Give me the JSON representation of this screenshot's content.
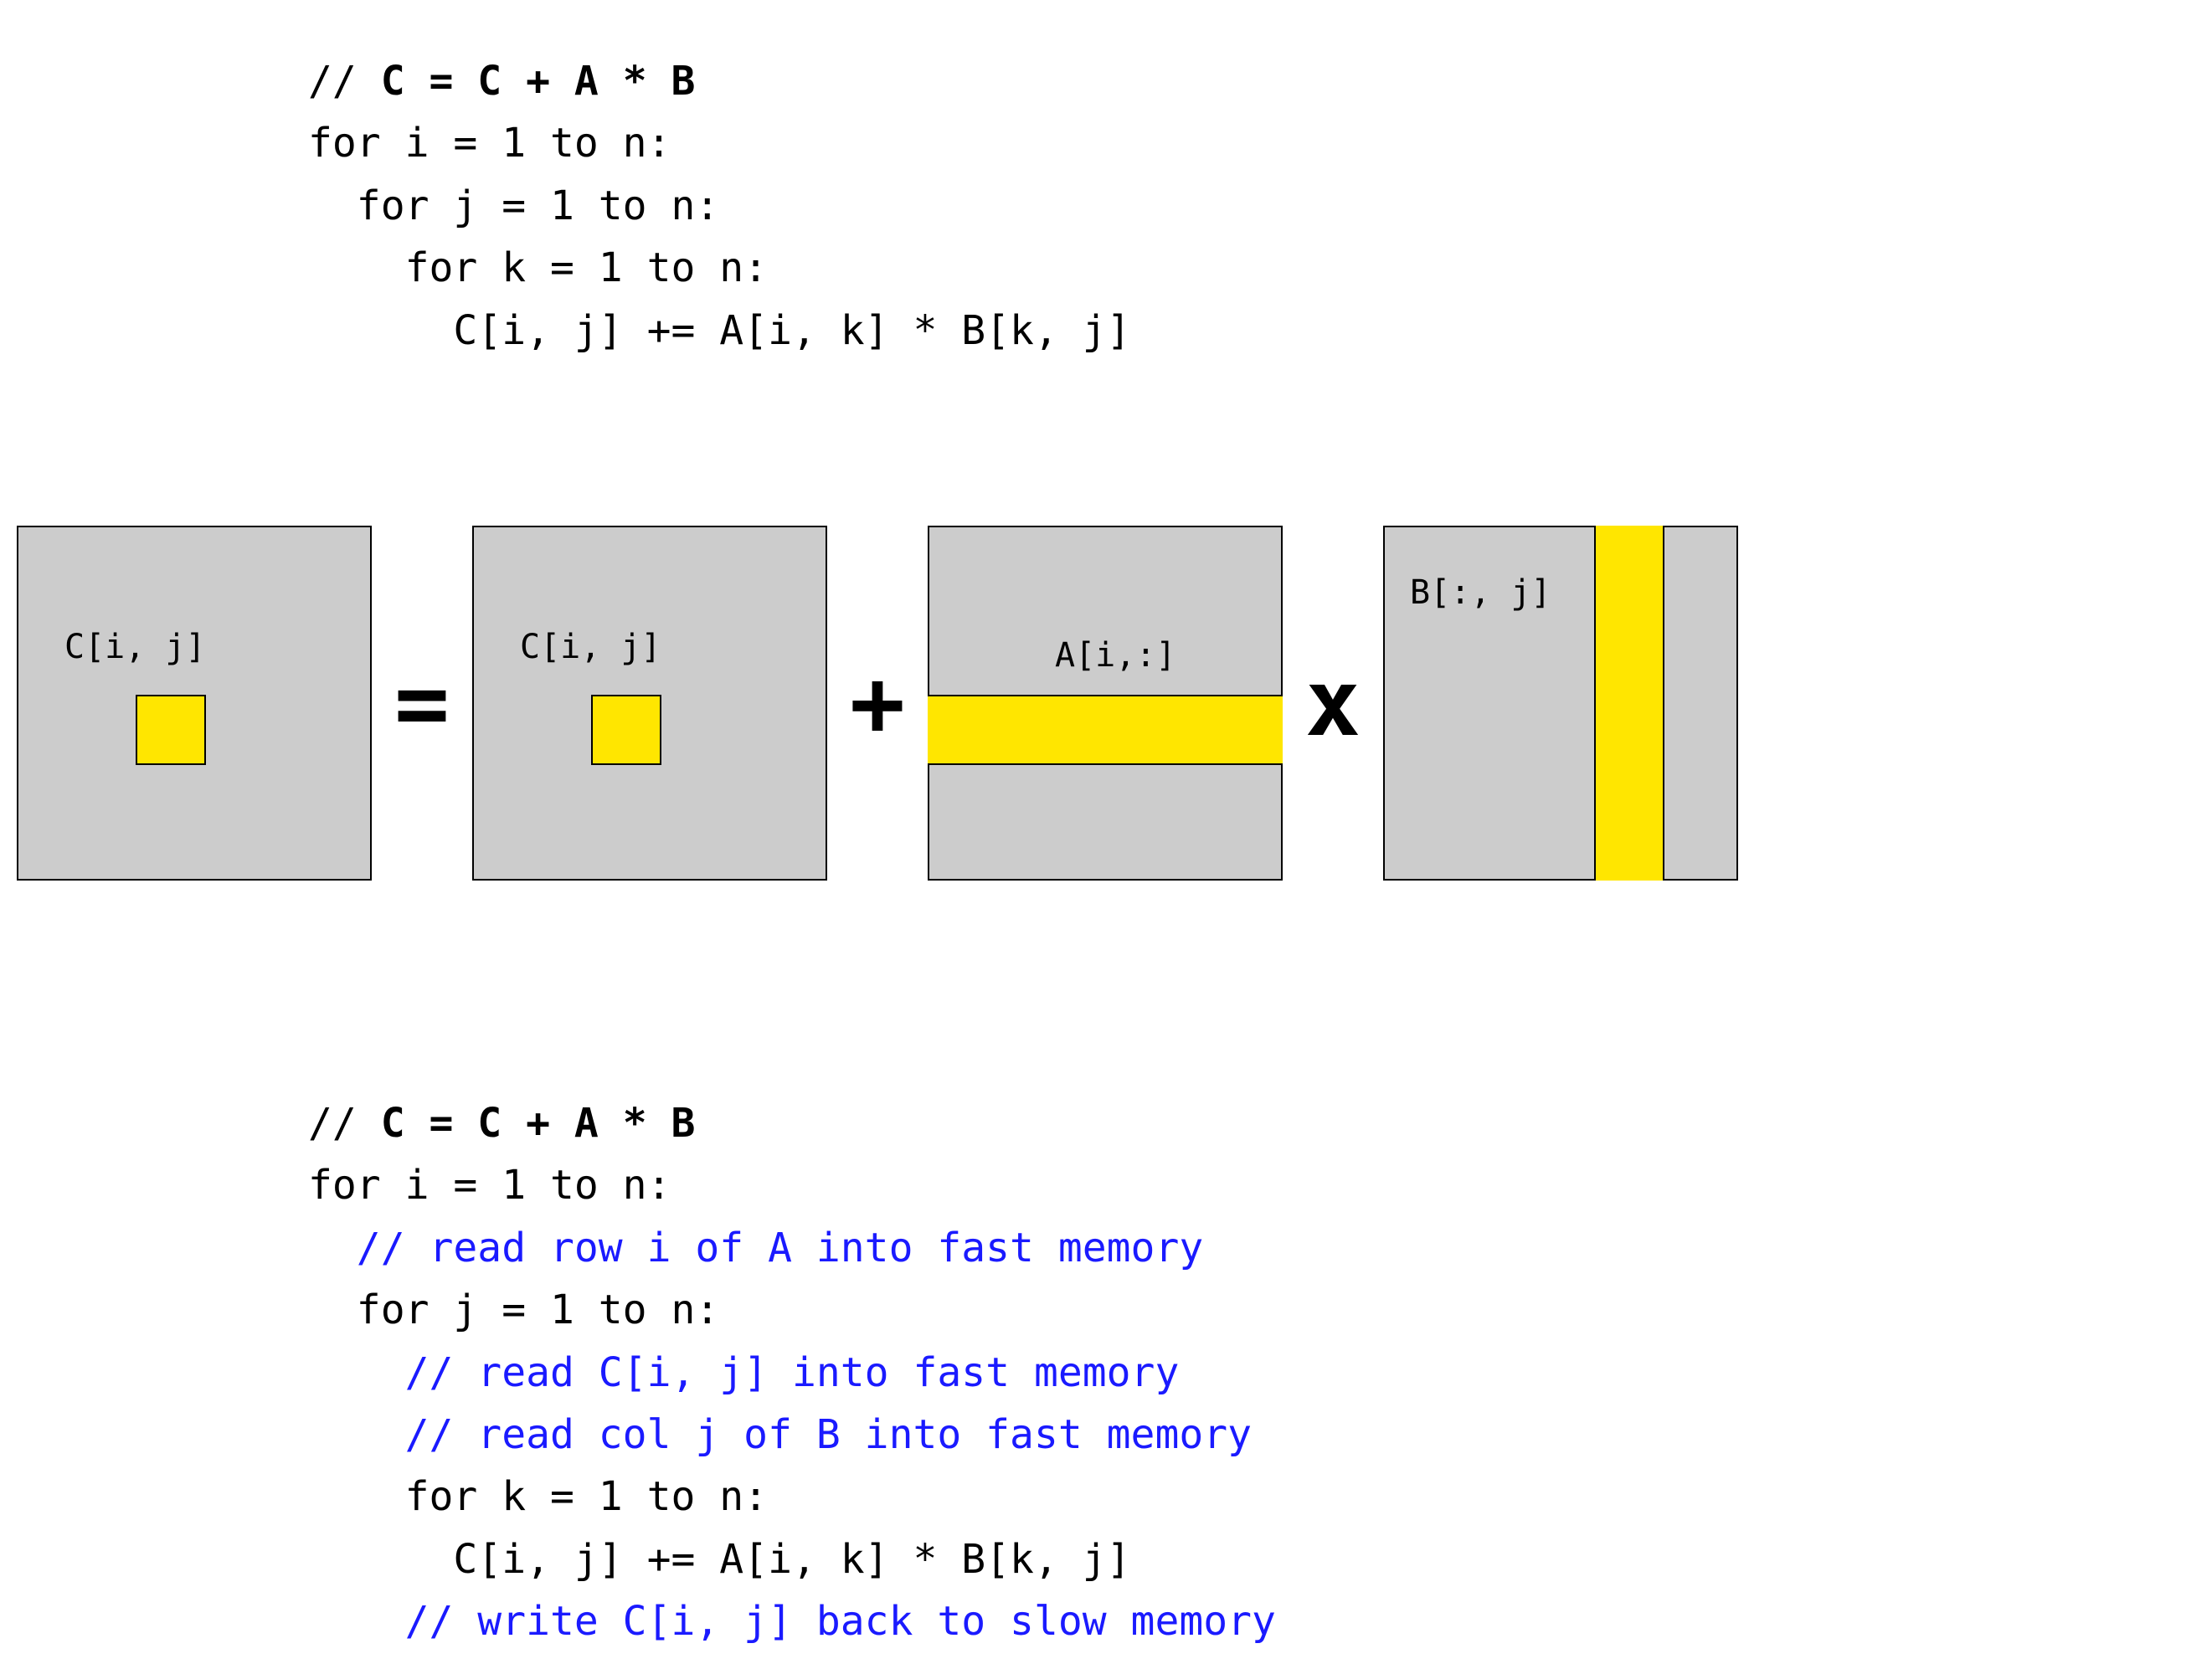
{
  "code_top": {
    "comment_prefix": "// ",
    "comment_bold": "C = C + A * B",
    "l1": "for i = 1 to n:",
    "l2": "  for j = 1 to n:",
    "l3": "    for k = 1 to n:",
    "l4": "      C[i, j] += A[i, k] * B[k, j]"
  },
  "diagram": {
    "matC1_label": "C[i, j]",
    "op_eq": "=",
    "matC2_label": "C[i, j]",
    "op_plus": "+",
    "matA_label": "A[i,:]",
    "op_times": "x",
    "matB_label": "B[:, j]",
    "highlight_color": "#ffe600",
    "matrix_fill": "#cccccc"
  },
  "code_bottom": {
    "comment_prefix": "// ",
    "comment_bold": "C = C + A * B",
    "l1": "for i = 1 to n:",
    "c1": "  // read row i of A into fast memory",
    "l2": "  for j = 1 to n:",
    "c2": "    // read C[i, j] into fast memory",
    "c3": "    // read col j of B into fast memory",
    "l3": "    for k = 1 to n:",
    "l4": "      C[i, j] += A[i, k] * B[k, j]",
    "c4": "    // write C[i, j] back to slow memory"
  }
}
